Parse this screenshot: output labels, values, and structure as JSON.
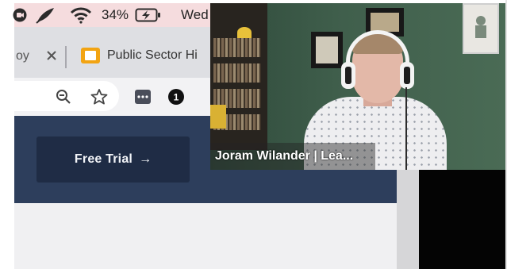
{
  "menubar": {
    "battery_percent": "34%",
    "day_text": "Wed",
    "icons": [
      "facetime-icon",
      "quill-icon",
      "wifi-icon",
      "battery-charging-icon"
    ]
  },
  "tabs": {
    "prev_tab_fragment": "oy",
    "active_tab_title": "Public Sector Hi",
    "icons": [
      "close-icon",
      "slides-favicon-icon"
    ]
  },
  "toolbar": {
    "badge_count": "1",
    "icons": [
      "zoom-out-icon",
      "bookmark-star-icon",
      "extension-icon",
      "extension-badge-icon"
    ]
  },
  "page": {
    "cta_label": "Free Trial",
    "cta_arrow": "→"
  },
  "video": {
    "caption": "Joram Wilander | Lea..."
  },
  "colors": {
    "hero_navy": "#2d3e5c",
    "button_navy": "#1f2c45",
    "tab_favicon": "#f2a413",
    "menubar_pink": "#f5dcde",
    "wall_green": "#405f4c"
  }
}
